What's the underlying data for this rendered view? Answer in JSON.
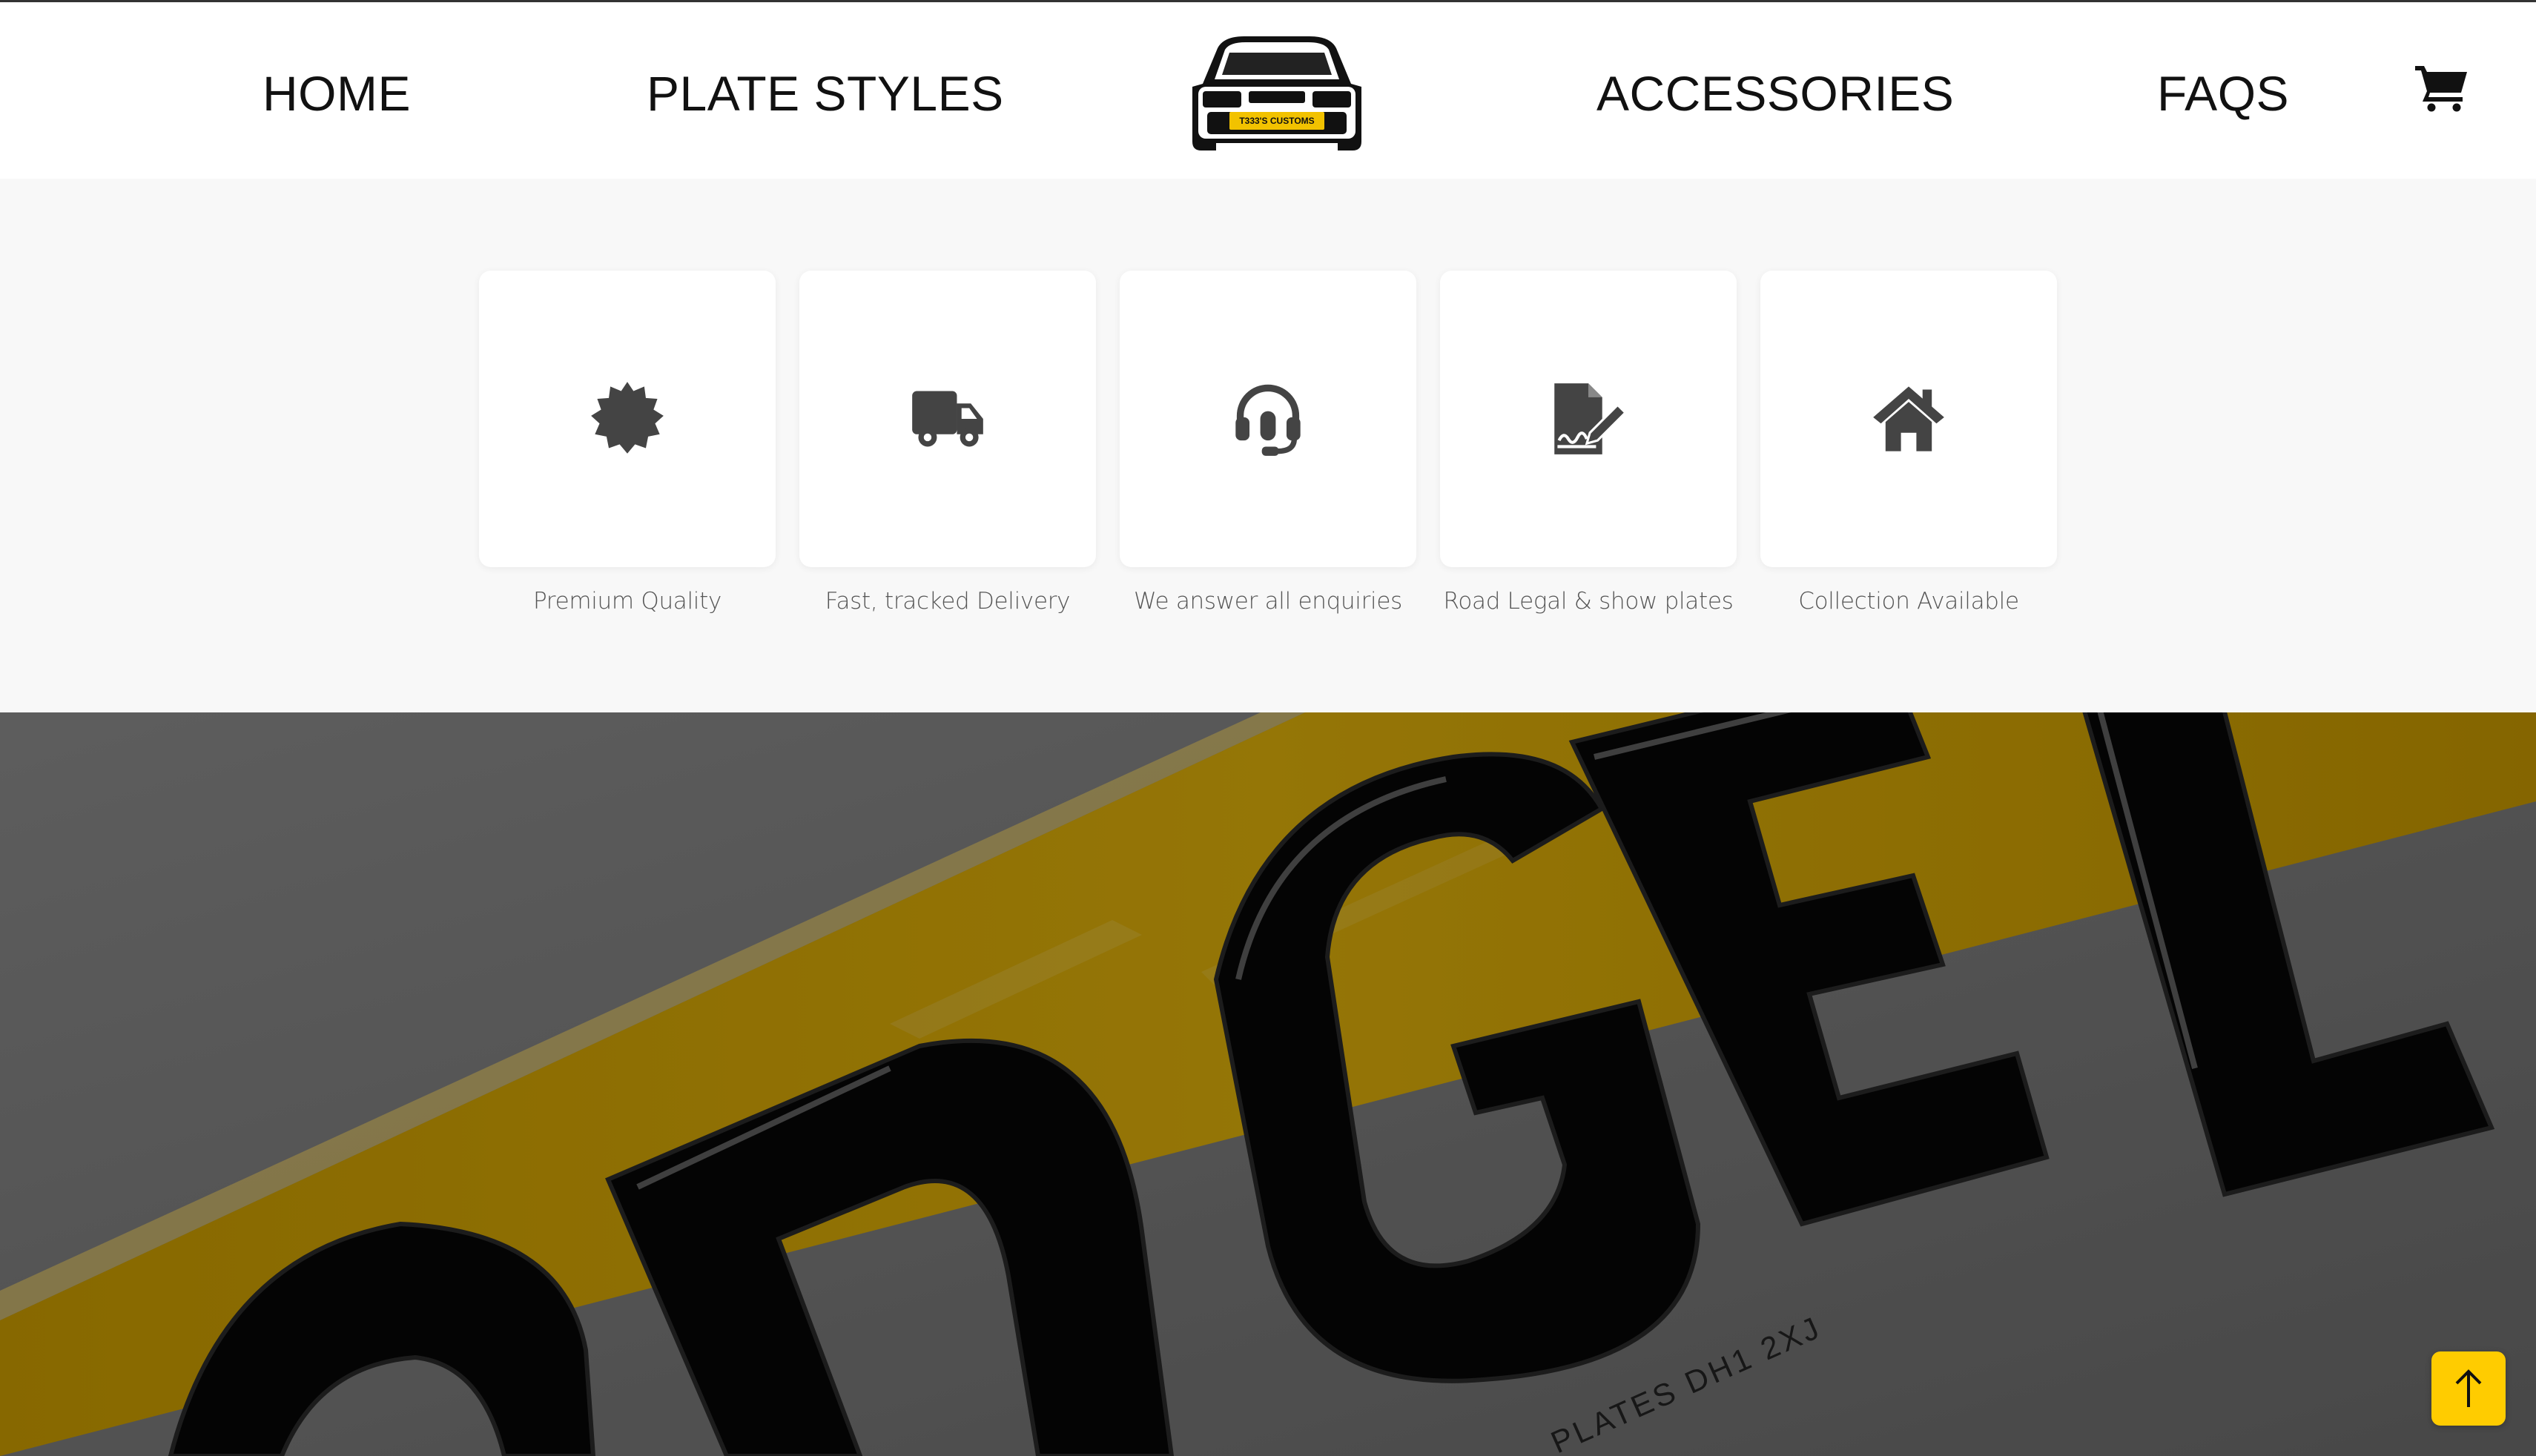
{
  "nav": {
    "home": "HOME",
    "plate_styles": "PLATE STYLES",
    "accessories": "ACCESSORIES",
    "faqs": "FAQS",
    "cart_icon": "shopping-cart-icon"
  },
  "logo": {
    "plate_text": "T333'S CUSTOMS",
    "icon": "car-front-logo"
  },
  "features": [
    {
      "label": "Premium Quality",
      "icon": "badge-icon"
    },
    {
      "label": "Fast, tracked Delivery",
      "icon": "truck-icon"
    },
    {
      "label": "We answer all enquiries",
      "icon": "headset-icon"
    },
    {
      "label": "Road Legal & show plates",
      "icon": "signed-document-icon"
    },
    {
      "label": "Collection Available",
      "icon": "home-icon"
    }
  ],
  "hero": {
    "plate_letters": "OD GEL",
    "small_print": "PLATES DH1 2XJ",
    "colors": {
      "plate": "#d6a800",
      "overlay": "rgba(0,0,0,0.45)"
    }
  },
  "back_to_top": {
    "icon": "arrow-up-icon",
    "color": "#ffcc00"
  }
}
